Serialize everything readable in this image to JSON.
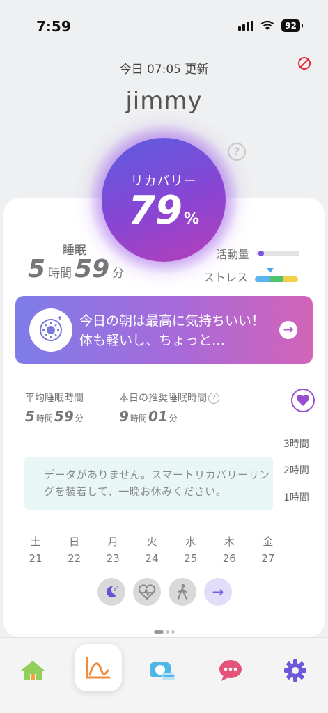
{
  "status_bar": {
    "time": "7:59",
    "battery": "92"
  },
  "header": {
    "updated": "今日 07:05 更新",
    "username": "jimmy",
    "help_symbol": "?"
  },
  "recovery": {
    "label": "リカバリー",
    "value": "79",
    "unit": "%"
  },
  "sleep": {
    "label": "睡眠",
    "hours": "5",
    "hours_unit": "時間",
    "minutes": "59",
    "minutes_unit": "分"
  },
  "metrics": {
    "activity_label": "活動量",
    "stress_label": "ストレス",
    "activity_level": 0.05,
    "stress_colors": [
      "#5ab4f0",
      "#4cc46c",
      "#f3d04a"
    ]
  },
  "banner": {
    "text": "今日の朝は最高に気持ちいい！体も軽いし、ちょっと…",
    "arrow": "→"
  },
  "sleep_stats": {
    "avg_label": "平均睡眠時間",
    "avg_hours": "5",
    "avg_hours_unit": "時間",
    "avg_minutes": "59",
    "avg_minutes_unit": "分",
    "rec_label": "本日の推奨睡眠時間",
    "rec_hours": "9",
    "rec_hours_unit": "時間",
    "rec_minutes": "01",
    "rec_minutes_unit": "分"
  },
  "chart": {
    "y_labels": [
      "3時間",
      "2時間",
      "1時間"
    ],
    "no_data": "データがありません。スマートリカバリーリングを装着して、一晩お休みください。",
    "days": [
      {
        "dow": "土",
        "date": "21"
      },
      {
        "dow": "日",
        "date": "22"
      },
      {
        "dow": "月",
        "date": "23"
      },
      {
        "dow": "火",
        "date": "24"
      },
      {
        "dow": "水",
        "date": "25"
      },
      {
        "dow": "木",
        "date": "26"
      },
      {
        "dow": "金",
        "date": "27"
      }
    ],
    "buttons": [
      "sleep-icon",
      "heart-rate-icon",
      "walk-icon",
      "arrow-right-icon"
    ]
  },
  "tabs": [
    "home-icon",
    "chart-icon",
    "camera-food-icon",
    "chat-icon",
    "gear-icon"
  ],
  "colors": {
    "accent_purple": "#7b52e6",
    "home_green": "#8fcf5a",
    "chart_orange": "#f08a3c",
    "chat_pink": "#e5527a",
    "gear_purple": "#6c58d8"
  }
}
